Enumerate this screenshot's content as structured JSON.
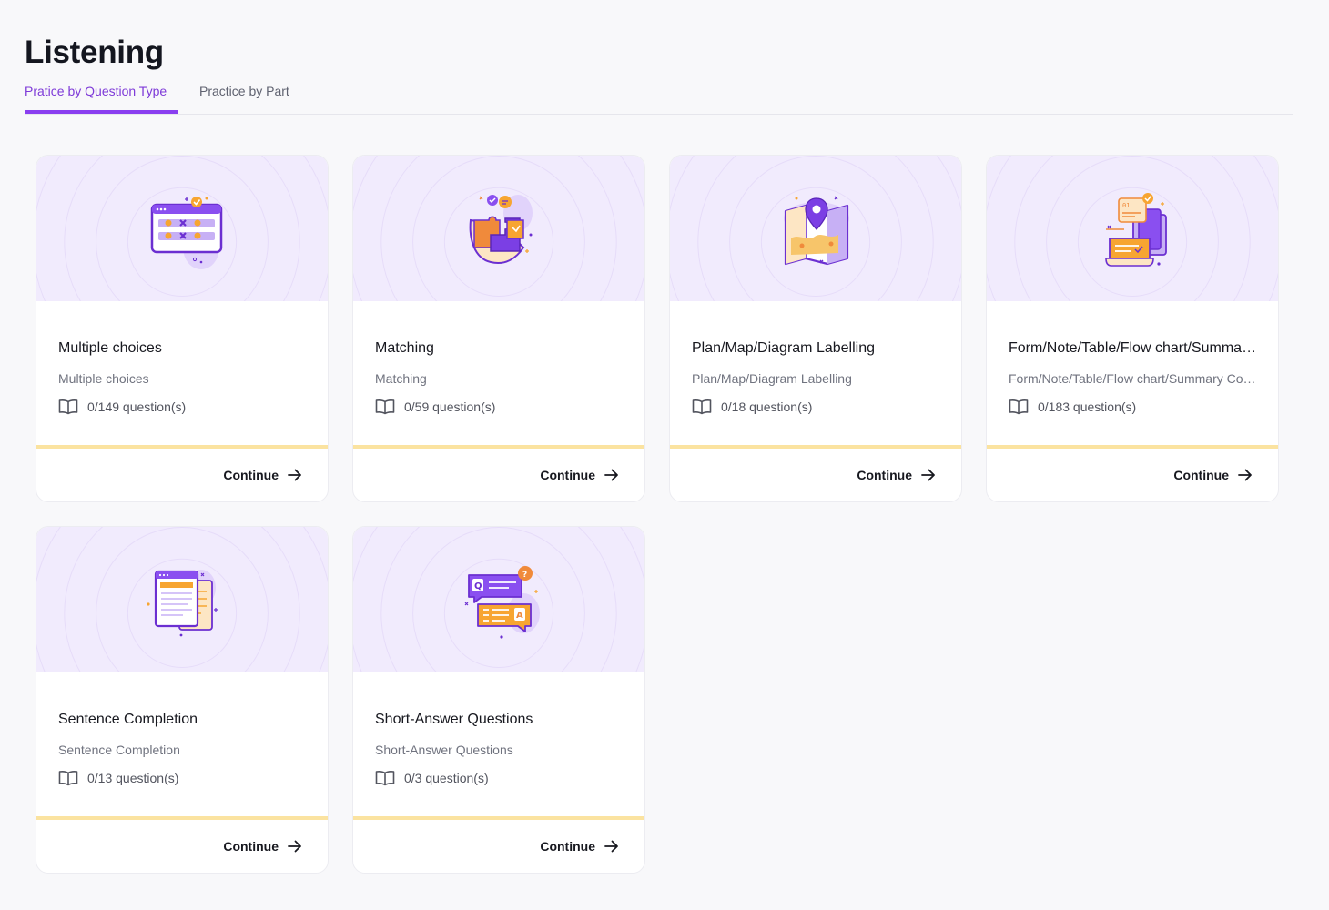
{
  "page": {
    "title": "Listening"
  },
  "tabs": [
    {
      "label": "Pratice by Question Type",
      "active": true
    },
    {
      "label": "Practice by Part",
      "active": false
    }
  ],
  "colors": {
    "accent": "#8a3ff0",
    "hero_bg": "#f1ebfd",
    "progress_bar": "#fbe3a0",
    "illustration_orange": "#f7a531"
  },
  "cards": [
    {
      "title": "Multiple choices",
      "subtitle": "Multiple choices",
      "progress": "0/149 question(s)",
      "button": "Continue",
      "icon": "multiple-choice-illustration"
    },
    {
      "title": "Matching",
      "subtitle": "Matching",
      "progress": "0/59 question(s)",
      "button": "Continue",
      "icon": "puzzle-illustration"
    },
    {
      "title": "Plan/Map/Diagram Labelling",
      "subtitle": "Plan/Map/Diagram Labelling",
      "progress": "0/18 question(s)",
      "button": "Continue",
      "icon": "map-illustration"
    },
    {
      "title": "Form/Note/Table/Flow chart/Summary Completion",
      "subtitle": "Form/Note/Table/Flow chart/Summary Completion",
      "progress": "0/183 question(s)",
      "button": "Continue",
      "icon": "form-illustration"
    },
    {
      "title": "Sentence Completion",
      "subtitle": "Sentence Completion",
      "progress": "0/13 question(s)",
      "button": "Continue",
      "icon": "document-illustration"
    },
    {
      "title": "Short-Answer Questions",
      "subtitle": "Short-Answer Questions",
      "progress": "0/3 question(s)",
      "button": "Continue",
      "icon": "qa-illustration"
    }
  ]
}
